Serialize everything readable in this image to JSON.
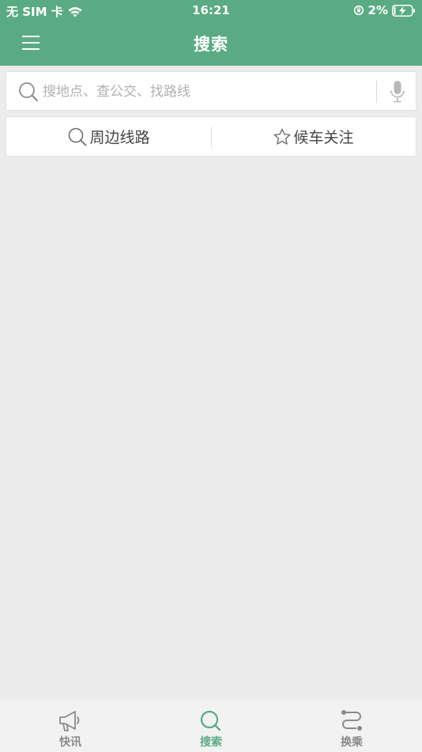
{
  "status_bar": {
    "carrier": "无 SIM 卡",
    "time": "16:21",
    "battery_percent": "2%"
  },
  "nav": {
    "title": "搜索"
  },
  "search": {
    "placeholder": "搜地点、查公交、找路线"
  },
  "actions": [
    {
      "label": "周边线路",
      "icon": "search-icon"
    },
    {
      "label": "候车关注",
      "icon": "star-icon"
    }
  ],
  "tabs": [
    {
      "label": "快讯",
      "icon": "megaphone-icon",
      "active": false
    },
    {
      "label": "搜索",
      "icon": "search-icon",
      "active": true
    },
    {
      "label": "换乘",
      "icon": "route-icon",
      "active": false
    }
  ],
  "colors": {
    "brand": "#5aab83",
    "background": "#ececec",
    "tab_inactive": "#8a8a8a"
  }
}
